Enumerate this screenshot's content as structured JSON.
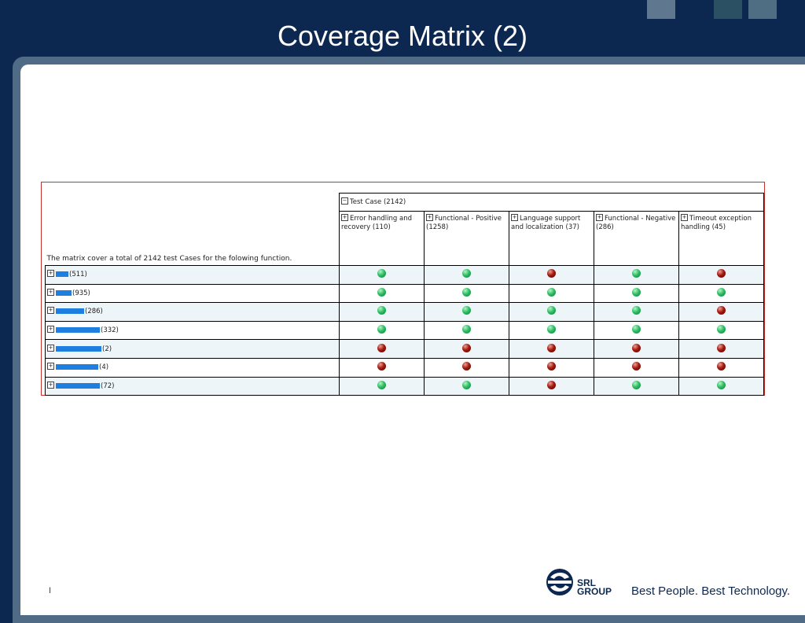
{
  "slide": {
    "title": "Coverage Matrix (2)",
    "slide_number": "I",
    "tagline": "Best People. Best Technology.",
    "logo_line1": "SRL",
    "logo_line2": "GROUP"
  },
  "colors": {
    "green": "#2ec065",
    "red": "#a8190f",
    "frame": "#0c2850",
    "matrix_border": "#c8302b"
  },
  "matrix": {
    "description": "The matrix cover a total of 2142 test Cases for the folowing function.",
    "group_header": "Test Case (2142)",
    "columns": [
      "Error handling and recovery (110)",
      "Functional - Positive (1258)",
      "Language support and localization (37)",
      "Functional - Negative (286)",
      "Timeout exception handling (45)"
    ],
    "rows": [
      {
        "count": "(511)",
        "status": [
          "green",
          "green",
          "red",
          "green",
          "red"
        ]
      },
      {
        "count": "(935)",
        "status": [
          "green",
          "green",
          "green",
          "green",
          "green"
        ]
      },
      {
        "count": "(286)",
        "status": [
          "green",
          "green",
          "green",
          "green",
          "red"
        ]
      },
      {
        "count": "(332)",
        "status": [
          "green",
          "green",
          "green",
          "green",
          "green"
        ]
      },
      {
        "count": "(2)",
        "status": [
          "red",
          "red",
          "red",
          "red",
          "red"
        ]
      },
      {
        "count": "(4)",
        "status": [
          "red",
          "red",
          "red",
          "red",
          "red"
        ]
      },
      {
        "count": "(72)",
        "status": [
          "green",
          "green",
          "red",
          "green",
          "green"
        ]
      }
    ]
  }
}
